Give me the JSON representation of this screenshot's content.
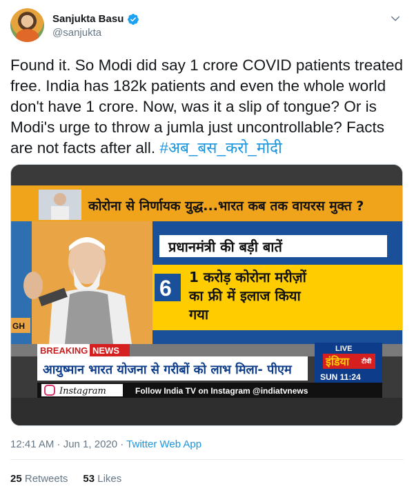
{
  "author": {
    "name": "Sanjukta Basu",
    "handle": "@sanjukta"
  },
  "tweet": {
    "text": "Found it. So Modi did say 1 crore COVID patients treated free. India has 182k patients and even the whole world don't have 1 crore. Now, was it a slip of tongue? Or is Modi's urge to throw a jumla just uncontrollable? Facts are not facts after all. ",
    "hashtag": "#अब_बस_करो_मोदी"
  },
  "media": {
    "headline": "कोरोना से निर्णायक युद्ध...भारत कब तक वायरस मुक्त ?",
    "subheadline": "प्रधानमंत्री की बड़ी बातें",
    "point_number": "6",
    "point_text_line1": "1 करोड़ कोरोना मरीज़ों",
    "point_text_line2": "का फ्री में इलाज किया",
    "point_text_line3": "गया",
    "breaking_label": "BREAKING",
    "news_label": "NEWS",
    "ticker_text": "आयुष्मान भारत योजना से गरीबों को लाभ मिला- पीएम",
    "live_label": "LIVE",
    "channel_name": "इंडिया",
    "channel_suffix": "टीवी",
    "clock": "SUN  11:24",
    "instagram_label": "Instagram",
    "follow_text": "Follow India TV on Instagram @indiatvnews",
    "gh_label": "GH"
  },
  "meta": {
    "time": "12:41 AM · Jun 1, 2020 · ",
    "app": "Twitter Web App"
  },
  "stats": {
    "retweets_count": "25",
    "retweets_label": "Retweets",
    "likes_count": "53",
    "likes_label": "Likes"
  },
  "colors": {
    "link": "#1b95e0",
    "muted": "#657786",
    "verified": "#1da1f2",
    "tv_orange": "#f5a623",
    "tv_yellow": "#ffcc00",
    "tv_blue": "#0d3c8a",
    "tv_red": "#d62020"
  },
  "icons": {
    "verified": "verified-badge-icon",
    "caret": "chevron-down-icon",
    "instagram": "instagram-icon"
  }
}
